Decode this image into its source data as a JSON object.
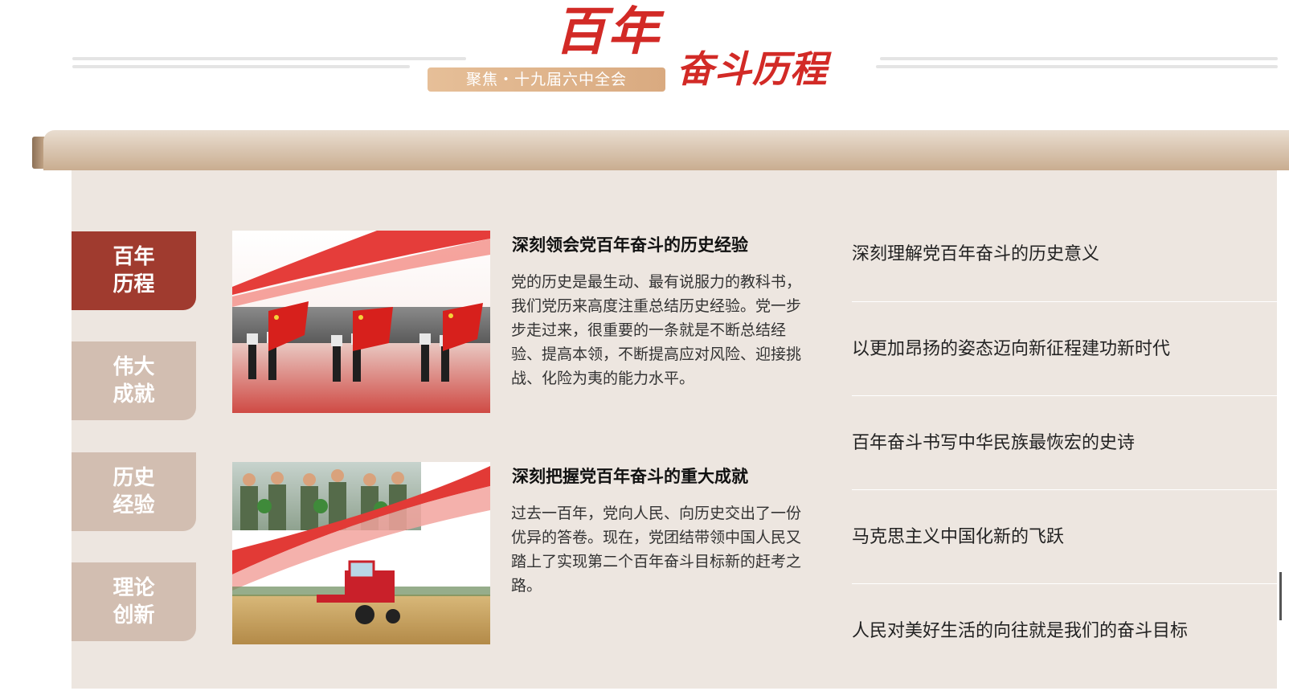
{
  "header": {
    "title_main": "百年",
    "title_sub": "奋斗历程",
    "pill_label": "聚焦・十九届六中全会"
  },
  "colors": {
    "accent_red": "#d22a26",
    "tab_active": "#a03b2f",
    "tab_inactive": "#d2beb1",
    "panel_bg": "#ede6e0",
    "pill_bg": "#e0b48a"
  },
  "tabs": [
    {
      "line1": "百年",
      "line2": "历程",
      "active": true
    },
    {
      "line1": "伟大",
      "line2": "成就",
      "active": false
    },
    {
      "line1": "历史",
      "line2": "经验",
      "active": false
    },
    {
      "line1": "理论",
      "line2": "创新",
      "active": false
    }
  ],
  "articles": [
    {
      "title": "深刻领会党百年奋斗的历史经验",
      "summary": "党的历史是最生动、最有说服力的教科书，我们党历来高度注重总结历史经验。党一步步走过来，很重要的一条就是不断总结经验、提高本领，不断提高应对风险、迎接挑战、化险为夷的能力水平。",
      "image": "flag-bearers-parade-photo"
    },
    {
      "title": "深刻把握党百年奋斗的重大成就",
      "summary": "过去一百年，党向人民、向历史交出了一份优异的答卷。现在，党团结带领中国人民又踏上了实现第二个百年奋斗目标新的赶考之路。",
      "image": "farmers-and-harvester-photo"
    }
  ],
  "links": [
    "深刻理解党百年奋斗的历史意义",
    "以更加昂扬的姿态迈向新征程建功新时代",
    "百年奋斗书写中华民族最恢宏的史诗",
    "马克思主义中国化新的飞跃",
    "人民对美好生活的向往就是我们的奋斗目标"
  ]
}
